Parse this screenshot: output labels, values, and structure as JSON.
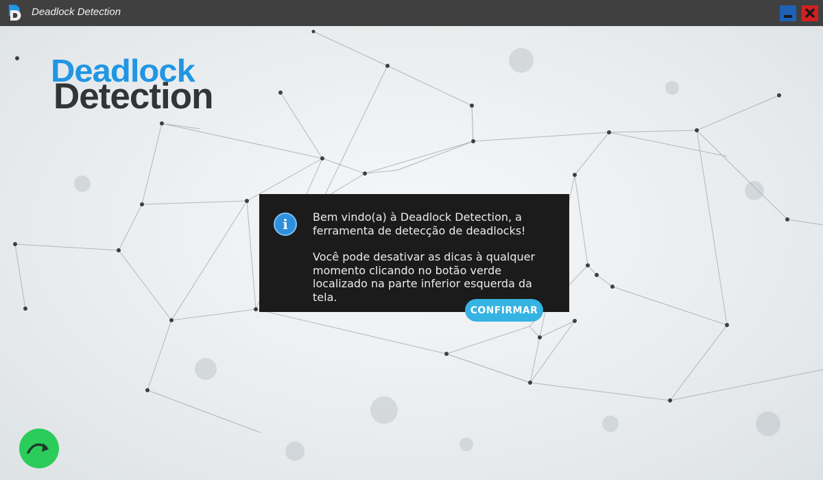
{
  "window": {
    "title": "Deadlock Detection",
    "icon": "deadlock-detection-app-icon",
    "minimize_icon": "minimize-icon",
    "close_icon": "close-icon"
  },
  "logo": {
    "line1": "Deadlock",
    "line2": "Detection"
  },
  "dialog": {
    "icon": "info-icon",
    "paragraph1": "Bem vindo(a) à Deadlock Detection, a ferramenta de detecção de deadlocks!",
    "paragraph2": "Você pode desativar as dicas à qualquer momento clicando no botão verde localizado na parte inferior esquerda da tela.",
    "confirm_label": "CONFIRMAR"
  },
  "tips_toggle": {
    "icon": "curved-arrow-icon"
  },
  "colors": {
    "titlebar": "#404040",
    "logo_blue": "#2196e3",
    "logo_dark": "#333436",
    "dialog_bg": "#1b1b1b",
    "confirm": "#35b3e3",
    "tips_green": "#2ccc5b",
    "minimize": "#1e62b8",
    "close": "#d42020"
  }
}
